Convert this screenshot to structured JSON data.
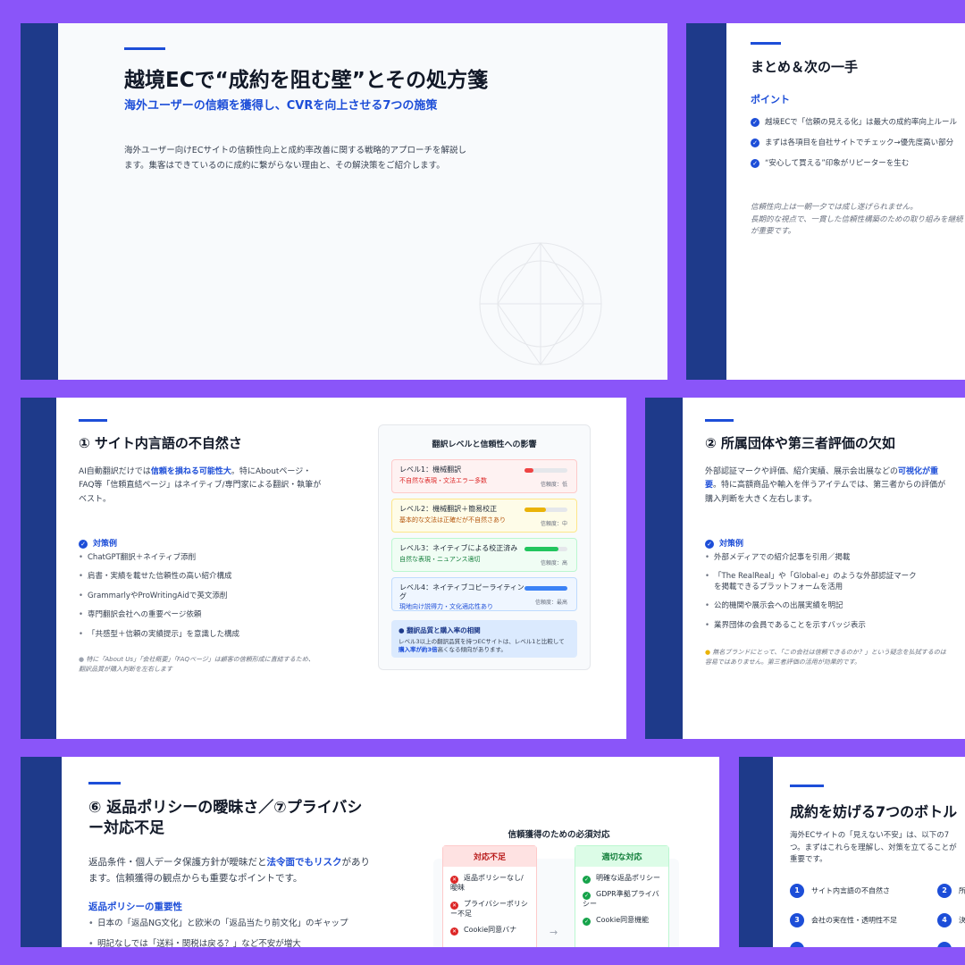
{
  "slide1": {
    "title": "越境ECで“成約を阻む壁”とその処方箋",
    "subtitle": "海外ユーザーの信頼を獲得し、CVRを向上させる7つの施策",
    "desc": "海外ユーザー向けECサイトの信頼性向上と成約率改善に関する戦略的アプローチを解説します。集客はできているのに成約に繋がらない理由と、その解決策をご紹介します。"
  },
  "slide2": {
    "title": "まとめ＆次の一手",
    "section": "ポイント",
    "points": [
      "越境ECで「信頼の見える化」は最大の成約率向上ルール",
      "まずは各項目を自社サイトでチェック→優先度高い部分",
      "“安心して買える”印象がリピーターを生む"
    ],
    "note1": "信頼性向上は一朝一夕では成し遂げられません。",
    "note2": "長期的な視点で、一貫した信頼性構築のための取り組みを継続",
    "note3": "が重要です。"
  },
  "slide3": {
    "title": "① サイト内言語の不自然さ",
    "intro_a": "AI自動翻訳だけでは",
    "intro_b": "信頼を損ねる可能性大",
    "intro_c": "。特にAboutページ・FAQ等「信頼直結ページ」はネイティブ/専門家による翻訳・執筆がベスト。",
    "measures_title": "対策例",
    "measures": [
      "ChatGPT翻訳＋ネイティブ添削",
      "肩書・実績を載せた信頼性の高い紹介構成",
      "GrammarlyやProWritingAidで英文添削",
      "専門翻訳会社への重要ページ依頼",
      "「共感型＋信頼の実績提示」を意識した構成"
    ],
    "footnote": "特に「About Us」「会社概要」「FAQページ」は顧客の信頼形成に直結するため、翻訳品質が購入判断を左右します",
    "panel_title": "翻訳レベルと信頼性への影響",
    "levels": [
      {
        "title": "レベル1：機械翻訳",
        "sub": "不自然な表現・文法エラー多数",
        "conf": "信頼度：低",
        "fill": 0.2,
        "color": "#ef4444",
        "bg": "#fef2f2",
        "border": "#fecaca",
        "subcolor": "#dc2626"
      },
      {
        "title": "レベル2：機械翻訳＋簡易校正",
        "sub": "基本的な文法は正確だが不自然さあり",
        "conf": "信頼度：中",
        "fill": 0.5,
        "color": "#eab308",
        "bg": "#fefce8",
        "border": "#fde68a",
        "subcolor": "#b45309"
      },
      {
        "title": "レベル3：ネイティブによる校正済み",
        "sub": "自然な表現・ニュアンス適切",
        "conf": "信頼度：高",
        "fill": 0.8,
        "color": "#22c55e",
        "bg": "#f0fdf4",
        "border": "#bbf7d0",
        "subcolor": "#15803d"
      },
      {
        "title": "レベル4：ネイティブコピーライティング",
        "sub": "現地向け説得力・文化適応性あり",
        "conf": "信頼度：最高",
        "fill": 1.0,
        "color": "#3b82f6",
        "bg": "#eff6ff",
        "border": "#bfdbfe",
        "subcolor": "#1d4ed8"
      }
    ],
    "insight_title": "翻訳品質と購入率の相関",
    "insight_a": "レベル3以上の翻訳品質を持つECサイトは、レベル1と比較して",
    "insight_b": "購入率が約3倍",
    "insight_c": "高くなる傾向があります。"
  },
  "slide4": {
    "title": "② 所属団体や第三者評価の欠如",
    "intro_a": "外部認証マークや評価、紹介実績、展示会出展などの",
    "intro_b": "可視化が重要",
    "intro_c": "。特に高額商品や輸入を伴うアイテムでは、第三者からの評価が購入判断を大きく左右します。",
    "measures_title": "対策例",
    "measures": [
      "外部メディアでの紹介記事を引用／掲載",
      "「The RealReal」や「Global-e」のような外部認証マークを掲載できるプラットフォームを活用",
      "公的機関や展示会への出展実績を明記",
      "業界団体の会員であることを示すバッジ表示"
    ],
    "footnote": "無名ブランドにとって、「この会社は信頼できるのか？」という疑念を払拭するのは容易ではありません。第三者評価の活用が効果的です。"
  },
  "slide5": {
    "title": "⑥ 返品ポリシーの曖昧さ／⑦プライバシー対応不足",
    "intro_a": "返品条件・個人データ保護方針が曖昧だと",
    "intro_b": "法令面でもリスク",
    "intro_c": "があります。信頼獲得の観点からも重要なポイントです。",
    "section": "返品ポリシーの重要性",
    "bullets": [
      "日本の「返品NG文化」と欧米の「返品当たり前文化」のギャップ",
      "明記なしでは「送料・関税は戻る？」など不安が増大"
    ],
    "panel_title": "信頼獲得のための必須対応",
    "bad_header": "対応不足",
    "good_header": "適切な対応",
    "bad": [
      "返品ポリシーなし/曖昧",
      "プライバシーポリシー不足",
      "Cookie同意バナ"
    ],
    "good": [
      "明確な返品ポリシー",
      "GDPR準拠プライバシー",
      "Cookie同意機能"
    ],
    "arrow": "→"
  },
  "slide6": {
    "title": "成約を妨げる7つのボトル",
    "intro": "海外ECサイトの「見えない不安」は、以下の7つ。まずはこれらを理解し、対策を立てることが重要です。",
    "items": [
      {
        "num": "1",
        "label": "サイト内言語の不自然さ"
      },
      {
        "num": "2",
        "label": "所"
      },
      {
        "num": "3",
        "label": "会社の実在性・透明性不足"
      },
      {
        "num": "4",
        "label": "決"
      }
    ]
  },
  "colors": {
    "background": "#8a55f9",
    "band": "#1e3a8a",
    "accent": "#1d4ed8"
  }
}
